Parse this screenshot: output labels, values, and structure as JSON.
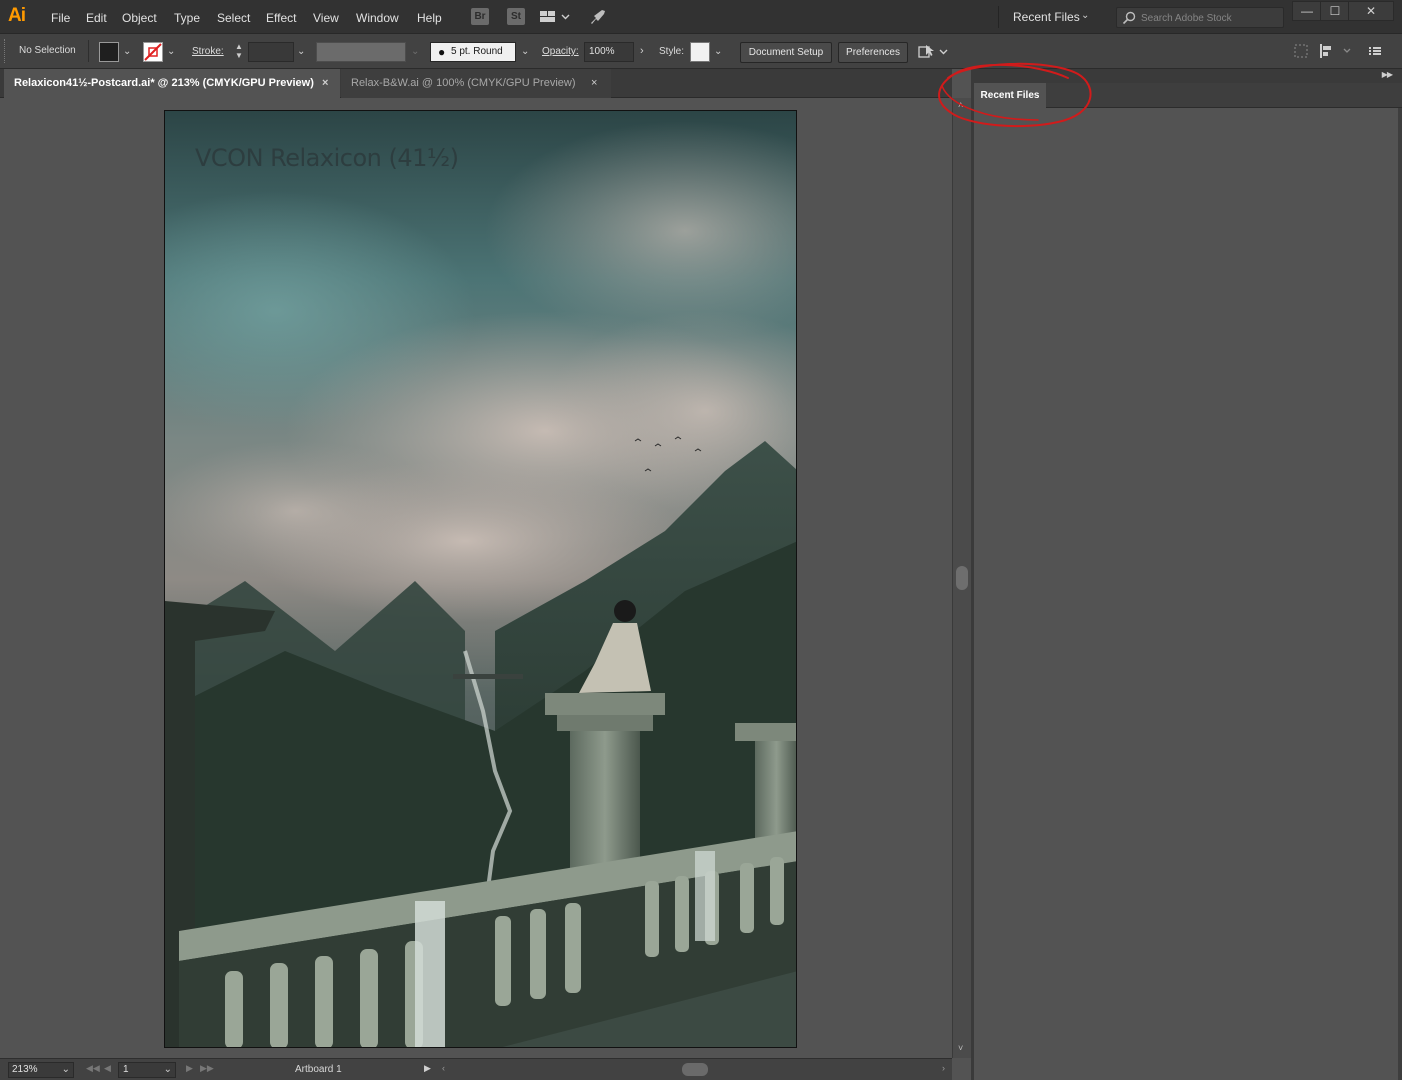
{
  "app": {
    "logo": "Ai"
  },
  "menu": {
    "items": [
      "File",
      "Edit",
      "Object",
      "Type",
      "Select",
      "Effect",
      "View",
      "Window",
      "Help"
    ]
  },
  "menubar_icons": {
    "bridge": "Br",
    "stock": "St"
  },
  "workspace": {
    "label": "Recent Files"
  },
  "search": {
    "placeholder": "Search Adobe Stock"
  },
  "window_controls": {
    "minimize": "—",
    "maximize": "☐",
    "close": "✕"
  },
  "control_bar": {
    "selection_label": "No Selection",
    "stroke_label": "Stroke:",
    "brush_label": "5 pt. Round",
    "opacity_label": "Opacity:",
    "opacity_value": "100%",
    "style_label": "Style:",
    "document_setup": "Document Setup",
    "preferences": "Preferences"
  },
  "tabs": [
    {
      "label": "Relaxicon41½-Postcard.ai* @ 213% (CMYK/GPU Preview)",
      "active": true
    },
    {
      "label": "Relax-B&W.ai @ 100% (CMYK/GPU Preview)",
      "active": false
    }
  ],
  "tab_close": "×",
  "artwork": {
    "title": "VCON Relaxicon (41½)"
  },
  "status": {
    "zoom": "213%",
    "page": "1",
    "artboard": "Artboard 1"
  },
  "panel": {
    "tab_label": "Recent Files"
  },
  "colors": {
    "logo_orange": "#ff9a00",
    "annotation_red": "#d11b1b",
    "chrome_dark": "#323232",
    "canvas_gray": "#535353"
  }
}
